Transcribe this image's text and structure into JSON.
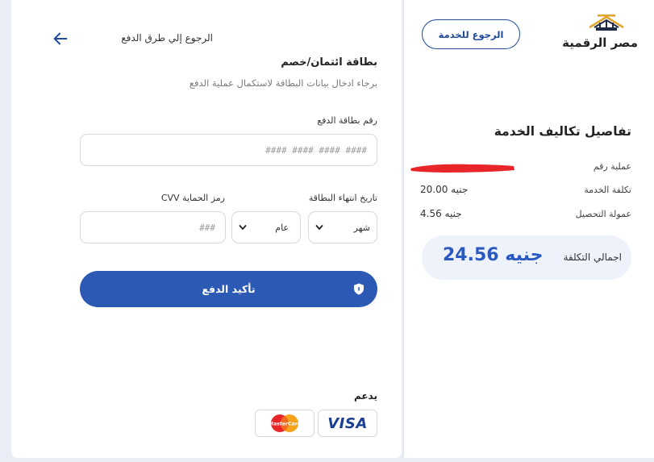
{
  "payment_form": {
    "back_link_label": "الرجوع إلي طرق الدفع",
    "title": "بطاقة ائتمان/خصم",
    "subtitle": "برجاء ادخال بيانات البطاقة لاستكمال عملية الدفع",
    "card_number": {
      "label": "رقم بطاقة الدفع",
      "placeholder": "#### #### #### ####",
      "value": ""
    },
    "expiry": {
      "label": "تاريخ انتهاء البطاقة",
      "month_selected": "شهر",
      "year_selected": "عام"
    },
    "cvv": {
      "label": "رمز الحماية CVV",
      "placeholder": "###",
      "value": ""
    },
    "submit_label": "تأكيد الدفع",
    "supports_label": "يدعم",
    "card_brands": [
      {
        "name": "VISA",
        "icon": "visa-logo"
      },
      {
        "name": "MasterCard",
        "icon": "mastercard-logo"
      }
    ]
  },
  "summary": {
    "logo_text": "مصر الرقمية",
    "return_button_label": "الرجوع للخدمة",
    "title": "تفاصيل تكاليف الخدمة",
    "rows": [
      {
        "label": "عملية رقم",
        "value": ""
      },
      {
        "label": "تكلفة الخدمة",
        "value": "20.00 جنيه"
      },
      {
        "label": "عمولة التحصيل",
        "value": "4.56 جنيه"
      }
    ],
    "total": {
      "label": "اجمالي التكلفة",
      "amount": "24.56",
      "currency": "جنيه"
    }
  },
  "colors": {
    "primary": "#2c59b4",
    "accent_text": "#2a59c2",
    "total_bg": "#eef2fb",
    "page_bg": "#e9eef6",
    "redaction": "#e8262a"
  }
}
